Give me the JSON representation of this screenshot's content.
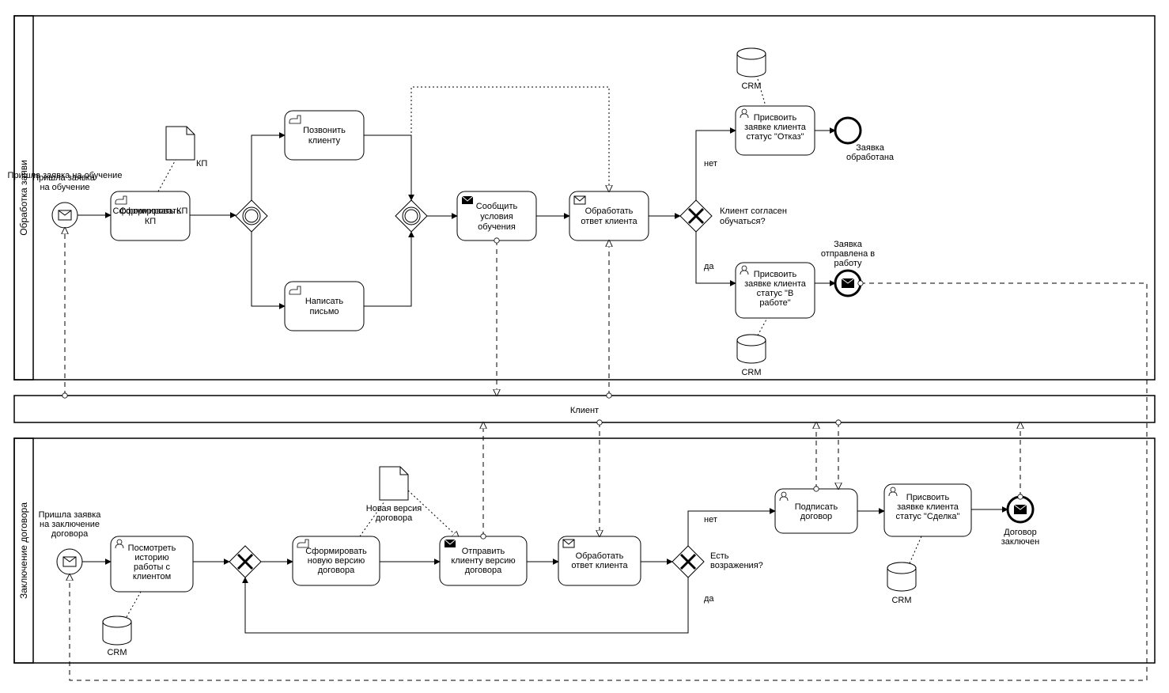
{
  "pools": {
    "top": {
      "title": "Обработка заяви"
    },
    "middle": {
      "title": "Клиент"
    },
    "bottom": {
      "title": "Заключение договора"
    }
  },
  "top": {
    "start_label": "Пришла заявка на обучение",
    "task_form_kp": "Сформировать КП",
    "doc_kp": "КП",
    "task_call": "Позвонить клиенту",
    "task_write": "Написать письмо",
    "task_inform": "Сообщить условия обучения",
    "task_process_reply": "Обработать ответ клиента",
    "gateway_q": "Клиент согласен обучаться?",
    "edge_no": "нет",
    "edge_yes": "да",
    "task_status_refuse": "Присвоить заявке клиента статус \"Отказ\"",
    "task_status_work": "Присвоить заявке клиента статус \"В работе\"",
    "end_processed": "Заявка обработана",
    "end_sent": "Заявка отправлена в работу",
    "crm_top": "CRM",
    "crm_mid": "CRM"
  },
  "bottom": {
    "start_label": "Пришла заявка на заключение договора",
    "task_history": "Посмотреть историю работы с клиентом",
    "crm_hist": "CRM",
    "task_new_version": "Сформировать новую версию договора",
    "doc_new_version": "Новая версия договора",
    "task_send_version": "Отправить клиенту версию договора",
    "task_process_reply": "Обработать ответ клиента",
    "gateway_q": "Есть возражения?",
    "edge_no": "нет",
    "edge_yes": "да",
    "task_sign": "Подписать договор",
    "task_status_deal": "Присвоить заявке клиента статус \"Сделка\"",
    "crm_deal": "CRM",
    "end_label": "Договор заключен"
  }
}
